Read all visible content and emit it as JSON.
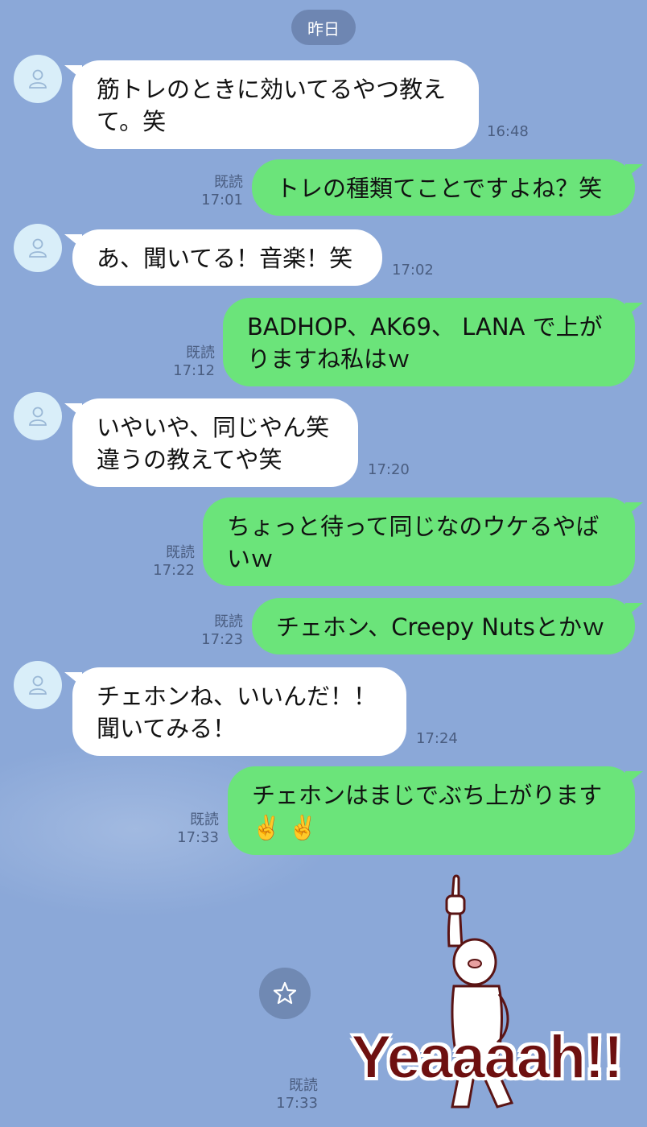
{
  "date_label": "昨日",
  "messages": [
    {
      "text_lines": [
        "筋トレのときに効いてるやつ教え",
        "て。笑"
      ],
      "time": "16:48"
    },
    {
      "text_lines": [
        "トレの種類てことですよね？笑"
      ],
      "read": "既読",
      "time": "17:01"
    },
    {
      "text_lines": [
        "あ、聞いてる！音楽！笑"
      ],
      "time": "17:02"
    },
    {
      "text_lines": [
        "BADHOP、AK69、 LANA で上が",
        "りますね私はｗ"
      ],
      "read": "既読",
      "time": "17:12"
    },
    {
      "text_lines": [
        "いやいや、同じやん笑",
        "違うの教えてや笑"
      ],
      "time": "17:20"
    },
    {
      "text_lines": [
        "ちょっと待って同じなのウケるやば",
        "いｗ"
      ],
      "read": "既読",
      "time": "17:22"
    },
    {
      "text_lines": [
        "チェホン、Creepy Nutsとかｗ"
      ],
      "read": "既読",
      "time": "17:23"
    },
    {
      "text_lines": [
        "チェホンね、いいんだ！！",
        "聞いてみる！"
      ],
      "time": "17:24"
    },
    {
      "text_lines": [
        "チェホンはまじでぶち上がります",
        "✌️ ✌️"
      ],
      "read": "既読",
      "time": "17:33"
    }
  ],
  "sticker": {
    "caption": "Yeaaaah!!",
    "read": "既読",
    "time": "17:33"
  },
  "icons": {
    "avatar": "person-outline-icon",
    "star": "star-outline-icon"
  },
  "colors": {
    "background": "#8BA8D8",
    "outgoing": "#6BE47A",
    "incoming": "#FFFFFF"
  }
}
